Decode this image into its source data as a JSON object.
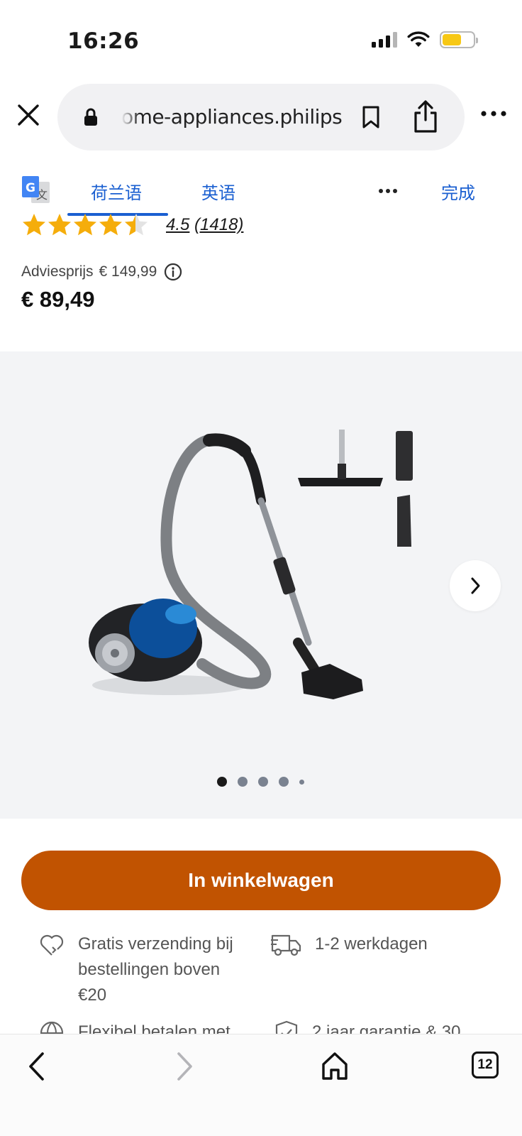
{
  "status_bar": {
    "time": "16:26"
  },
  "browser": {
    "url": "ome-appliances.philips"
  },
  "translate": {
    "source_lang": "荷兰语",
    "target_lang": "英语",
    "done_label": "完成"
  },
  "product": {
    "rating_value": "4.5",
    "rating_count": "(1418)",
    "stars_filled": 4.5,
    "stars_total": 5,
    "list_price_label": "Adviesprijs",
    "list_price": "€ 149,99",
    "price": "€ 89,49",
    "gallery_page_index": 1,
    "gallery_dots": 5
  },
  "cart": {
    "label": "In winkelwagen"
  },
  "benefits": [
    {
      "icon": "heart-return-icon",
      "text": "Gratis verzending bij bestellingen boven €20"
    },
    {
      "icon": "delivery-truck-icon",
      "text": "1-2 werkdagen"
    },
    {
      "icon": "globe-icon",
      "text": "Flexibel betalen met"
    },
    {
      "icon": "shield-check-icon",
      "text": "2 jaar garantie & 30"
    }
  ],
  "toolbar": {
    "tabs_count": "12"
  },
  "colors": {
    "accent_orange": "#c15301",
    "link_blue": "#1a5fd1",
    "star_gold": "#f5ad0b",
    "gallery_bg": "#f3f4f6"
  }
}
